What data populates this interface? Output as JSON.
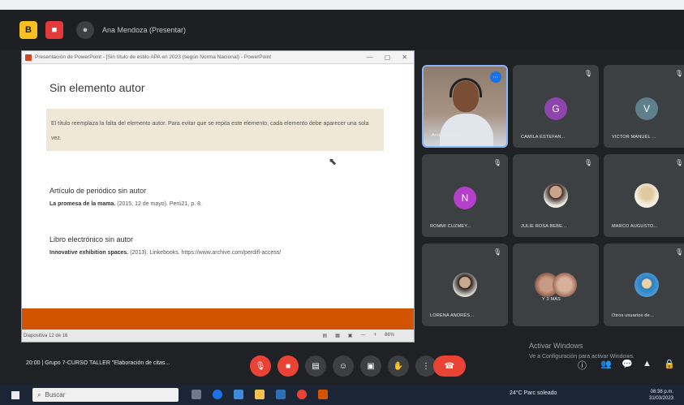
{
  "topbar": {
    "btn1_label": "B",
    "btn2_label": "■",
    "presenter_title": "Ana Mendoza (Presentar)"
  },
  "powerpoint": {
    "window_title": "Presentación de PowerPoint - [Sin título de estilo APA en 2023 (según Norma Nacional) - PowerPoint",
    "window_controls": [
      "—",
      "▢",
      "✕"
    ],
    "slide": {
      "title": "Sin elemento autor",
      "callout_text": "El título reemplaza la falta del elemento autor. Para evitar que se repita este elemento, cada elemento debe aparecer una sola vez.",
      "section1_heading": "Artículo de periódico sin autor",
      "section1_bold": "La promesa de la mama.",
      "section1_rest": " (2015, 12 de mayo). Perú21, p. 8.",
      "section2_heading": "Libro electrónico sin autor",
      "section2_bold": "Innovative exhibition spaces.",
      "section2_rest": " (2013). Linkebooks. https://www.archive.com/perdifl-access/"
    },
    "status_left": "Diapositiva 12 de 16",
    "status_right": [
      "▤",
      "▦",
      "▣",
      "—",
      "+",
      "86%"
    ]
  },
  "participants": [
    {
      "name": "Ana Mendoza",
      "type": "video"
    },
    {
      "name": "CAMILA ESTEFAN...",
      "initial": "G",
      "avatar_color": "#8e44ad"
    },
    {
      "name": "VICTOR MANUEL ...",
      "initial": "V",
      "avatar_color": "#5f7f8a"
    },
    {
      "name": "ROMMI CUZMEY...",
      "initial": "N",
      "avatar_color": "#b43fc9"
    },
    {
      "name": "JULIE ROSA BEBE...",
      "type": "photo"
    },
    {
      "name": "MARCO AUGUSTO...",
      "type": "photo"
    },
    {
      "name": "LORENA ANDRÉS...",
      "type": "photo"
    },
    {
      "name": "Y 3 MÁS",
      "type": "group"
    },
    {
      "name": "Otros usuarios de...",
      "type": "photo"
    }
  ],
  "activation": {
    "line1": "Activar Windows",
    "line2": "Ve a Configuración para activar Windows."
  },
  "meeting": {
    "info": "20:00 | Grupo 7-CURSO TALLER \"Elaboración de citas..."
  },
  "taskbar": {
    "search_placeholder": "Buscar",
    "tray_text": "24°C Parc soleado",
    "time": "08:38 p.m.",
    "date": "31/03/2023"
  },
  "colors": {
    "accent_orange": "#d35400",
    "callout_bg": "#efe8d8",
    "end_call_red": "#ea4335",
    "active_border": "#8ab4f8"
  }
}
